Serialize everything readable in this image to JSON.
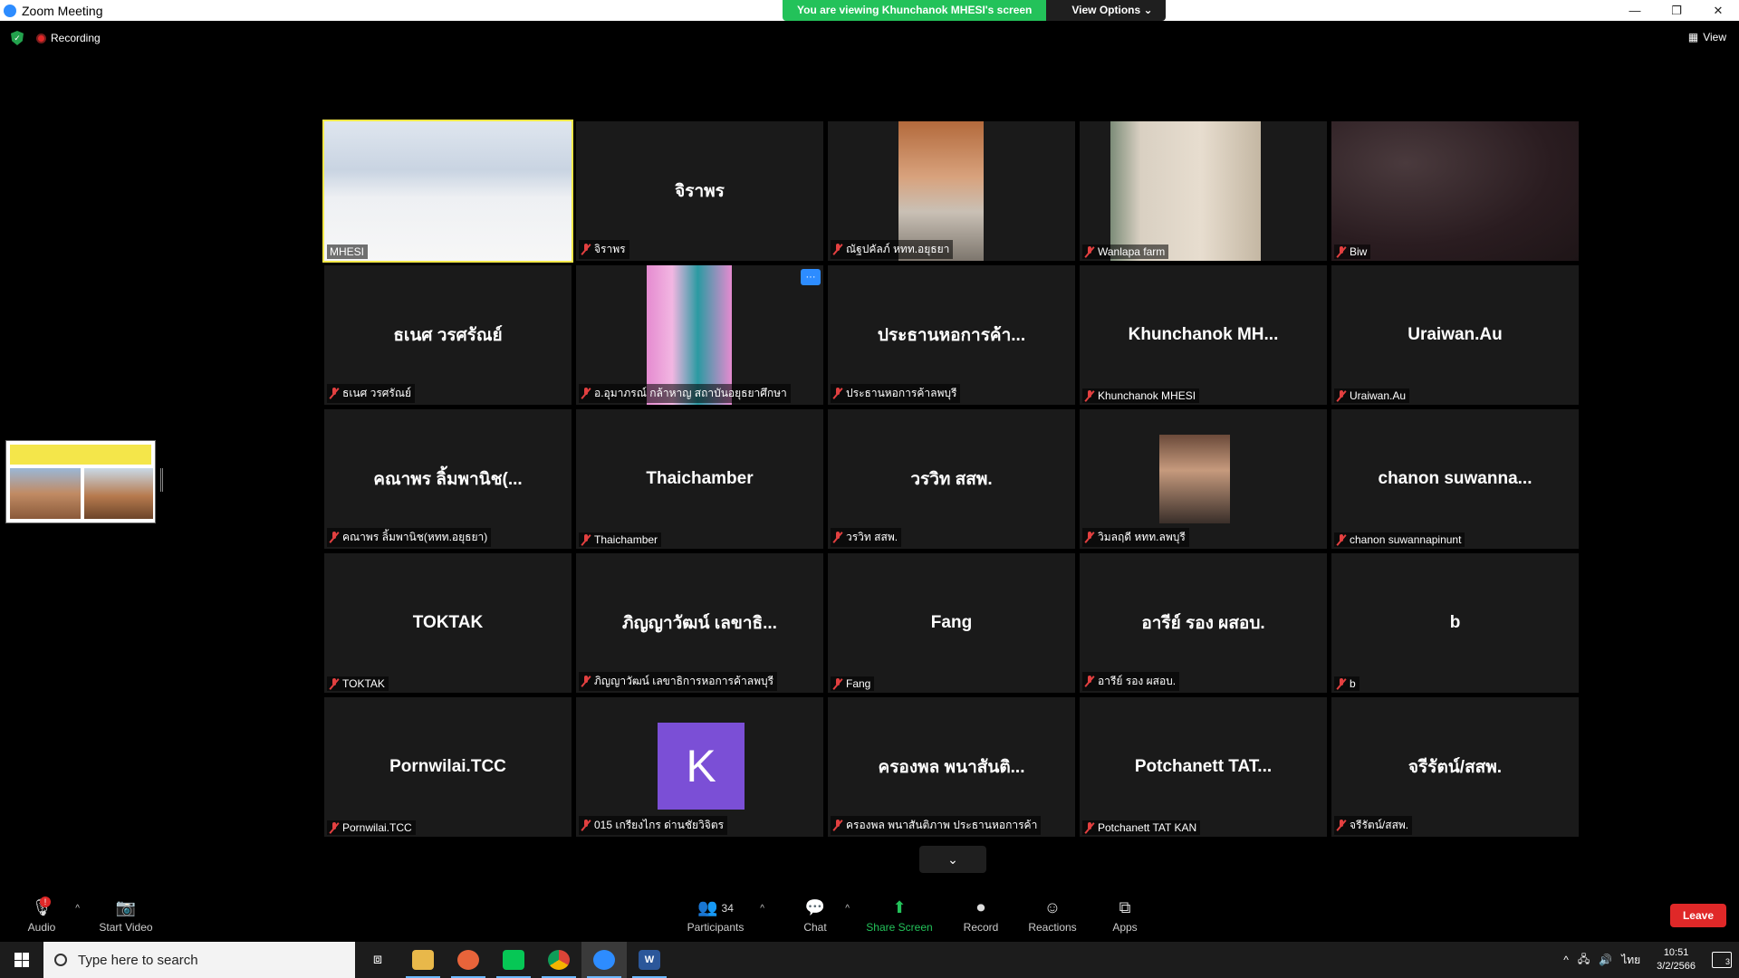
{
  "window": {
    "title": "Zoom Meeting"
  },
  "banner": {
    "message": "You are viewing Khunchanok MHESI's screen",
    "view_options": "View Options ⌄"
  },
  "status": {
    "recording": "Recording",
    "view": "View"
  },
  "tiles": [
    {
      "big": "",
      "label": "MHESI",
      "type": "video-room",
      "active": true,
      "muted": false
    },
    {
      "big": "จิราพร",
      "label": "จิราพร",
      "type": "name",
      "muted": true
    },
    {
      "big": "",
      "label": "ณัฐปคัลภ์ หทท.อยุธยา",
      "type": "video-man",
      "muted": true
    },
    {
      "big": "",
      "label": "Wanlapa farm",
      "type": "video-wall",
      "muted": true
    },
    {
      "big": "",
      "label": "Biw",
      "type": "video-dark",
      "muted": true
    },
    {
      "big": "ธเนศ วรศรัณย์",
      "label": "ธเนศ วรศรัณย์",
      "type": "name",
      "muted": true
    },
    {
      "big": "",
      "label": "อ.อุมาภรณ์ กล้าหาญ สถาบันอยุธยาศึกษา",
      "type": "video-woman",
      "muted": true,
      "more": true
    },
    {
      "big": "ประธานหอการค้า...",
      "label": "ประธานหอการค้าลพบุรี",
      "type": "name",
      "muted": true
    },
    {
      "big": "Khunchanok  MH...",
      "label": "Khunchanok MHESI",
      "type": "name",
      "muted": true
    },
    {
      "big": "Uraiwan.Au",
      "label": "Uraiwan.Au",
      "type": "name",
      "muted": true
    },
    {
      "big": "คณาพร ลิ้มพานิช(...",
      "label": "คณาพร ลิ้มพานิช(หทท.อยุธยา)",
      "type": "name",
      "muted": true
    },
    {
      "big": "Thaichamber",
      "label": "Thaichamber",
      "type": "name",
      "muted": true
    },
    {
      "big": "วรวิท สสพ.",
      "label": "วรวิท สสพ.",
      "type": "name",
      "muted": true
    },
    {
      "big": "",
      "label": "วิมลฤดี หทท.ลพบุรี",
      "type": "video-portrait",
      "muted": true
    },
    {
      "big": "chanon  suwanna...",
      "label": "chanon suwannapinunt",
      "type": "name",
      "muted": true
    },
    {
      "big": "TOKTAK",
      "label": "TOKTAK",
      "type": "name",
      "muted": true
    },
    {
      "big": "ภิญญาวัฒน์ เลขาธิ...",
      "label": "ภิญญาวัฒน์ เลขาธิการหอการค้าลพบุรี",
      "type": "name",
      "muted": true
    },
    {
      "big": "Fang",
      "label": "Fang",
      "type": "name",
      "muted": true
    },
    {
      "big": "อารีย์ รอง ผสอบ.",
      "label": "อารีย์ รอง ผสอบ.",
      "type": "name",
      "muted": true
    },
    {
      "big": "b",
      "label": "b",
      "type": "name",
      "muted": true
    },
    {
      "big": "Pornwilai.TCC",
      "label": "Pornwilai.TCC",
      "type": "name",
      "muted": true
    },
    {
      "big": "K",
      "label": "015 เกรียงไกร ด่านชัยวิจิตร",
      "type": "avatar",
      "muted": true
    },
    {
      "big": "ครองพล พนาสันติ...",
      "label": "ครองพล พนาสันติภาพ ประธานหอการค้า",
      "type": "name",
      "muted": true
    },
    {
      "big": "Potchanett  TAT...",
      "label": "Potchanett  TAT KAN",
      "type": "name",
      "muted": true
    },
    {
      "big": "จรีรัตน์/สสพ.",
      "label": "จรีรัตน์/สสพ.",
      "type": "name",
      "muted": true
    }
  ],
  "toolbar": {
    "audio": "Audio",
    "audio_badge": "!",
    "start_video": "Start Video",
    "participants": "Participants",
    "participants_count": "34",
    "chat": "Chat",
    "share_screen": "Share Screen",
    "record": "Record",
    "reactions": "Reactions",
    "apps": "Apps",
    "leave": "Leave"
  },
  "taskbar": {
    "search_placeholder": "Type here to search",
    "language": "ไทย",
    "time": "10:51",
    "date": "3/2/2566",
    "notifications": "3"
  },
  "colors": {
    "active_border": "#f6e94a",
    "banner_green": "#23c25a",
    "leave_red": "#e02828",
    "zoom_blue": "#2d8cff"
  }
}
